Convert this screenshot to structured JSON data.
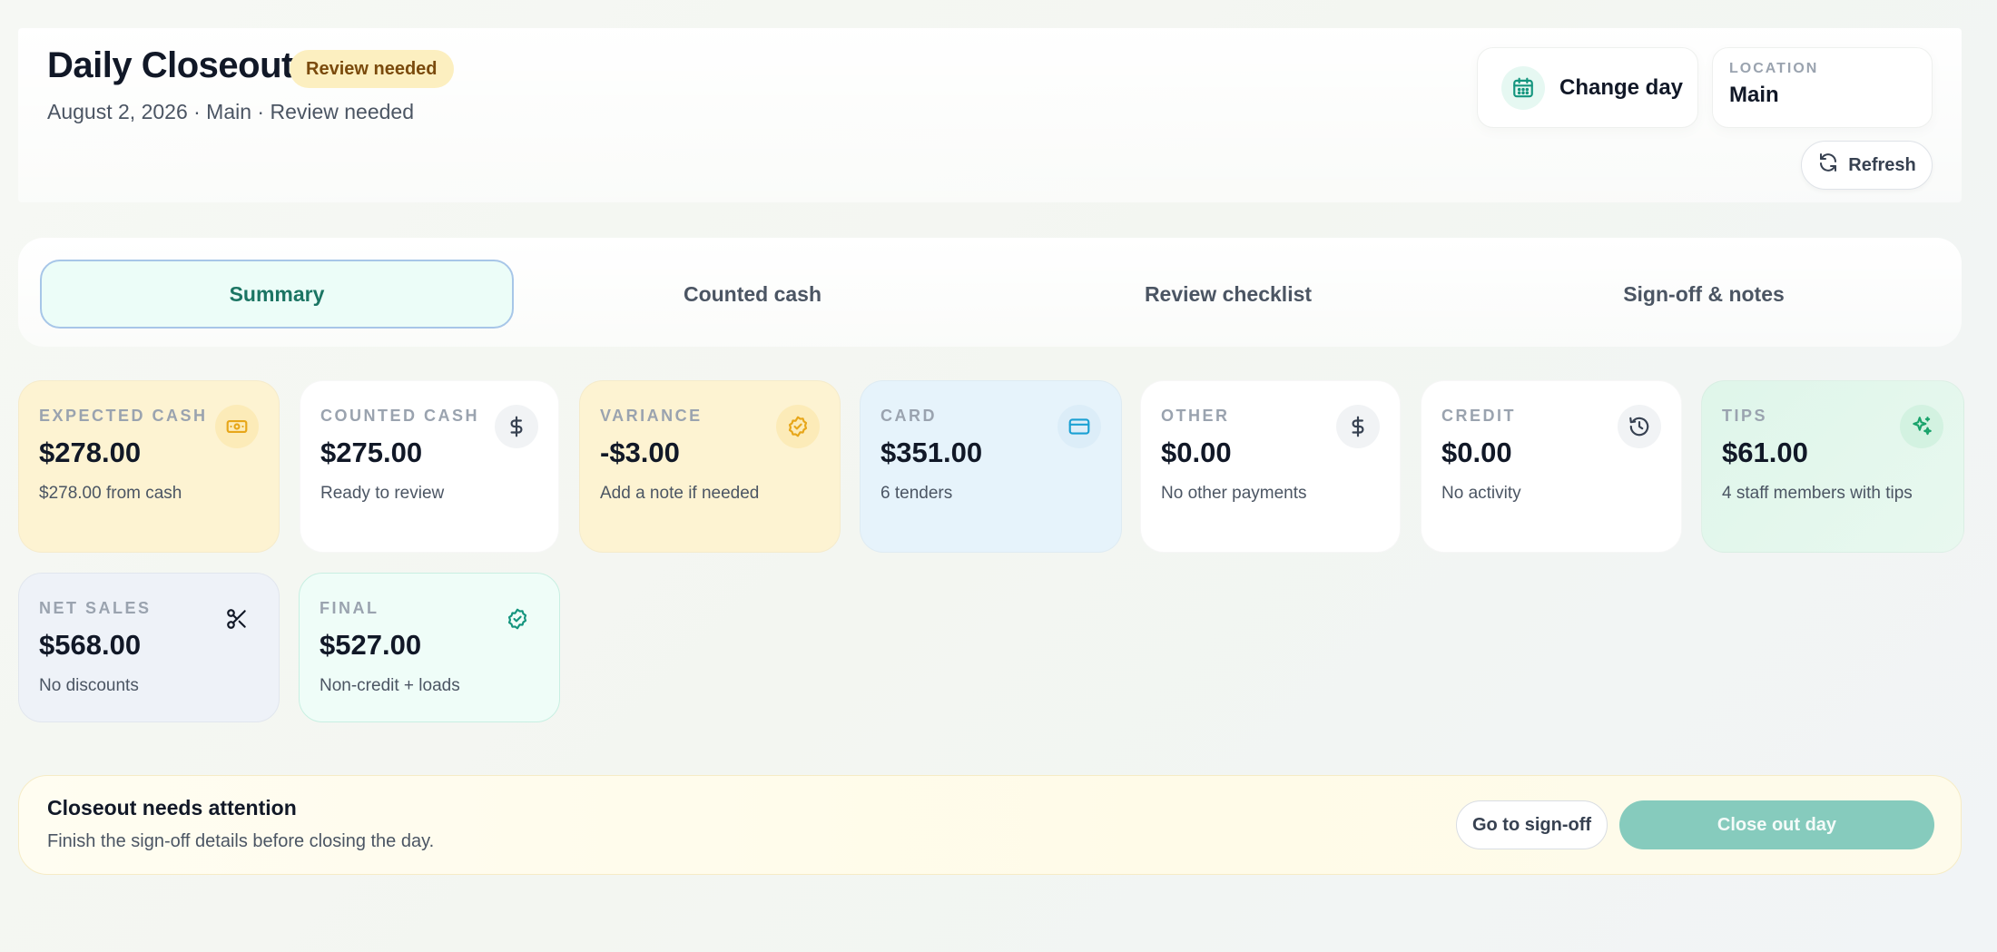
{
  "header": {
    "title": "Daily Closeout",
    "status_badge": "Review needed",
    "subtitle": "August 2, 2026 · Main · Review needed",
    "change_day_label": "Change day",
    "location_label": "LOCATION",
    "location_value": "Main",
    "refresh_label": "Refresh"
  },
  "tabs": [
    {
      "label": "Summary",
      "active": true
    },
    {
      "label": "Counted cash",
      "active": false
    },
    {
      "label": "Review checklist",
      "active": false
    },
    {
      "label": "Sign-off & notes",
      "active": false
    }
  ],
  "stats": [
    {
      "label": "EXPECTED CASH",
      "value": "$278.00",
      "sub": "$278.00 from cash",
      "icon": "banknote-icon",
      "accent": "#e7a619"
    },
    {
      "label": "COUNTED CASH",
      "value": "$275.00",
      "sub": "Ready to review",
      "icon": "dollar-icon",
      "accent": "#374151"
    },
    {
      "label": "VARIANCE",
      "value": "-$3.00",
      "sub": "Add a note if needed",
      "icon": "badge-check-icon",
      "accent": "#e7a619"
    },
    {
      "label": "CARD",
      "value": "$351.00",
      "sub": "6 tenders",
      "icon": "credit-card-icon",
      "accent": "#1aa0d3"
    },
    {
      "label": "OTHER",
      "value": "$0.00",
      "sub": "No other payments",
      "icon": "dollar-icon",
      "accent": "#374151"
    },
    {
      "label": "CREDIT",
      "value": "$0.00",
      "sub": "No activity",
      "icon": "history-icon",
      "accent": "#374151"
    },
    {
      "label": "TIPS",
      "value": "$61.00",
      "sub": "4 staff members with tips",
      "icon": "sparkles-icon",
      "accent": "#19a36b"
    },
    {
      "label": "NET SALES",
      "value": "$568.00",
      "sub": "No discounts",
      "icon": "scissors-icon",
      "accent": "#111827"
    },
    {
      "label": "FINAL",
      "value": "$527.00",
      "sub": "Non-credit + loads",
      "icon": "badge-check-icon",
      "accent": "#14957e"
    }
  ],
  "attention": {
    "title": "Closeout needs attention",
    "message": "Finish the sign-off details before closing the day.",
    "signoff_label": "Go to sign-off",
    "closeout_label": "Close out day"
  },
  "colors": {
    "primary": "#14957e",
    "primary_disabled": "#86cbbd",
    "warning_bg": "#fcefc0"
  }
}
